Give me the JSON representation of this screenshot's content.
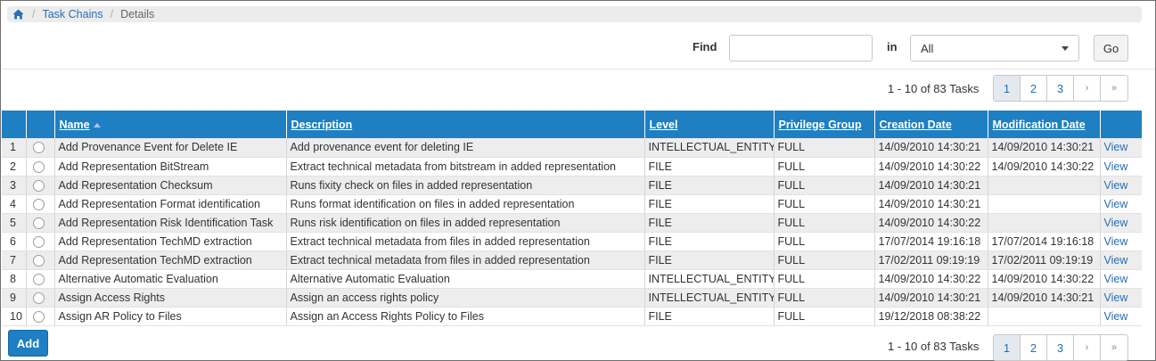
{
  "breadcrumb": {
    "home_icon": "home-icon",
    "items": [
      "Task Chains",
      "Details"
    ]
  },
  "find": {
    "label": "Find",
    "value": "",
    "placeholder": "",
    "in_label": "in",
    "scope_selected": "All",
    "go_label": "Go"
  },
  "pagination": {
    "summary": "1 - 10 of 83 Tasks",
    "pages": [
      "1",
      "2",
      "3"
    ],
    "active_page": "1",
    "next_label": "›",
    "last_label": "»"
  },
  "table": {
    "columns": [
      "",
      "",
      "Name",
      "Description",
      "Level",
      "Privilege Group",
      "Creation Date",
      "Modification Date",
      ""
    ],
    "sorted_column": "Name",
    "sort_direction": "ascending",
    "rows": [
      {
        "n": "1",
        "name": "Add Provenance Event for Delete IE",
        "description": "Add provenance event for deleting IE",
        "level": "INTELLECTUAL_ENTITY",
        "privilege": "FULL",
        "created": "14/09/2010 14:30:21",
        "modified": "14/09/2010 14:30:21",
        "action": "View"
      },
      {
        "n": "2",
        "name": "Add Representation BitStream",
        "description": "Extract technical metadata from bitstream in added representation",
        "level": "FILE",
        "privilege": "FULL",
        "created": "14/09/2010 14:30:22",
        "modified": "14/09/2010 14:30:22",
        "action": "View"
      },
      {
        "n": "3",
        "name": "Add Representation Checksum",
        "description": "Runs fixity check on files in added representation",
        "level": "FILE",
        "privilege": "FULL",
        "created": "14/09/2010 14:30:21",
        "modified": "",
        "action": "View"
      },
      {
        "n": "4",
        "name": "Add Representation Format identification",
        "description": "Runs format identification on files in added representation",
        "level": "FILE",
        "privilege": "FULL",
        "created": "14/09/2010 14:30:21",
        "modified": "",
        "action": "View"
      },
      {
        "n": "5",
        "name": "Add Representation Risk Identification Task",
        "description": "Runs risk identification on files in added representation",
        "level": "FILE",
        "privilege": "FULL",
        "created": "14/09/2010 14:30:22",
        "modified": "",
        "action": "View"
      },
      {
        "n": "6",
        "name": "Add Representation TechMD extraction",
        "description": "Extract technical metadata from files in added representation",
        "level": "FILE",
        "privilege": "FULL",
        "created": "17/07/2014 19:16:18",
        "modified": "17/07/2014 19:16:18",
        "action": "View"
      },
      {
        "n": "7",
        "name": "Add Representation TechMD extraction",
        "description": "Extract technical metadata from files in added representation",
        "level": "FILE",
        "privilege": "FULL",
        "created": "17/02/2011 09:19:19",
        "modified": "17/02/2011 09:19:19",
        "action": "View"
      },
      {
        "n": "8",
        "name": "Alternative Automatic Evaluation",
        "description": "Alternative Automatic Evaluation",
        "level": "INTELLECTUAL_ENTITY",
        "privilege": "FULL",
        "created": "14/09/2010 14:30:22",
        "modified": "14/09/2010 14:30:22",
        "action": "View"
      },
      {
        "n": "9",
        "name": "Assign Access Rights",
        "description": "Assign an access rights policy",
        "level": "INTELLECTUAL_ENTITY",
        "privilege": "FULL",
        "created": "14/09/2010 14:30:21",
        "modified": "14/09/2010 14:30:21",
        "action": "View"
      },
      {
        "n": "10",
        "name": "Assign AR Policy to Files",
        "description": "Assign an Access Rights Policy to Files",
        "level": "FILE",
        "privilege": "FULL",
        "created": "19/12/2018 08:38:22",
        "modified": "",
        "action": "View"
      }
    ]
  },
  "actions": {
    "add_label": "Add"
  },
  "colors": {
    "header_blue": "#1e7fc2",
    "link_blue": "#2a6eb5",
    "row_alt": "#ededed",
    "breadcrumb_bg": "#ececec"
  }
}
